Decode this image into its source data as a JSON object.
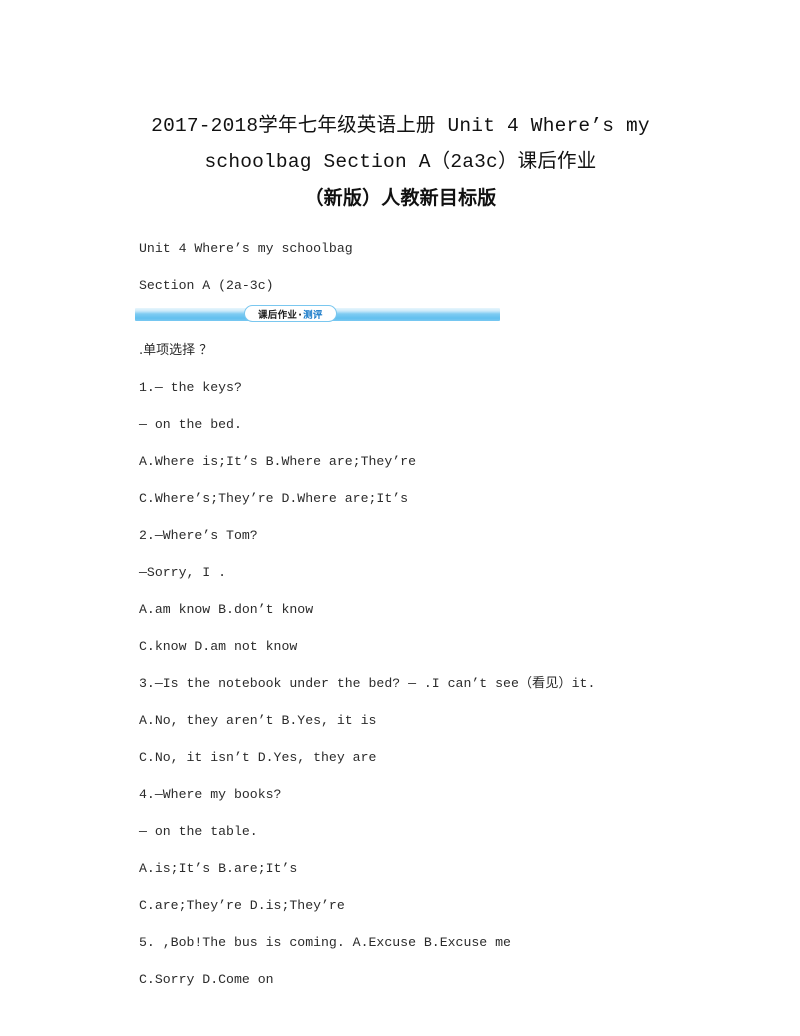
{
  "document": {
    "title_lines": [
      "2017-2018学年七年级英语上册 Unit 4 Where’s my",
      "schoolbag Section A（2a3c）课后作业",
      "（新版）人教新目标版"
    ],
    "unit_heading": "Unit 4 Where’s my schoolbag",
    "section_heading": "Section A (2a-3c)",
    "banner": {
      "label_main": "课后作业",
      "label_separator": "·",
      "label_accent": "测评",
      "bar_color": "#62c0ef",
      "bar_highlight": "#cdebfa",
      "accent_color": "#1478c8"
    },
    "section_title": ".单项选择 ？",
    "questions": [
      {
        "stem_lines": [
          "1.— the keys?",
          "— on the bed."
        ],
        "option_lines": [
          "A.Where is;It’s B.Where are;They’re",
          "C.Where’s;They’re D.Where are;It’s"
        ]
      },
      {
        "stem_lines": [
          "2.—Where’s Tom?",
          "—Sorry, I ."
        ],
        "option_lines": [
          "A.am know B.don’t know",
          "C.know D.am not know"
        ]
      },
      {
        "stem_lines": [
          "3.—Is the notebook under the bed? — .I can’t see（看见）it."
        ],
        "option_lines": [
          "A.No, they aren’t B.Yes, it is",
          "C.No, it isn’t D.Yes, they are"
        ]
      },
      {
        "stem_lines": [
          "4.—Where my books?",
          "— on the table."
        ],
        "option_lines": [
          "A.is;It’s B.are;It’s",
          "C.are;They’re D.is;They’re"
        ]
      },
      {
        "stem_lines": [
          "5. ,Bob!The bus is coming. A.Excuse B.Excuse me"
        ],
        "option_lines": [
          "C.Sorry D.Come on"
        ]
      }
    ]
  }
}
